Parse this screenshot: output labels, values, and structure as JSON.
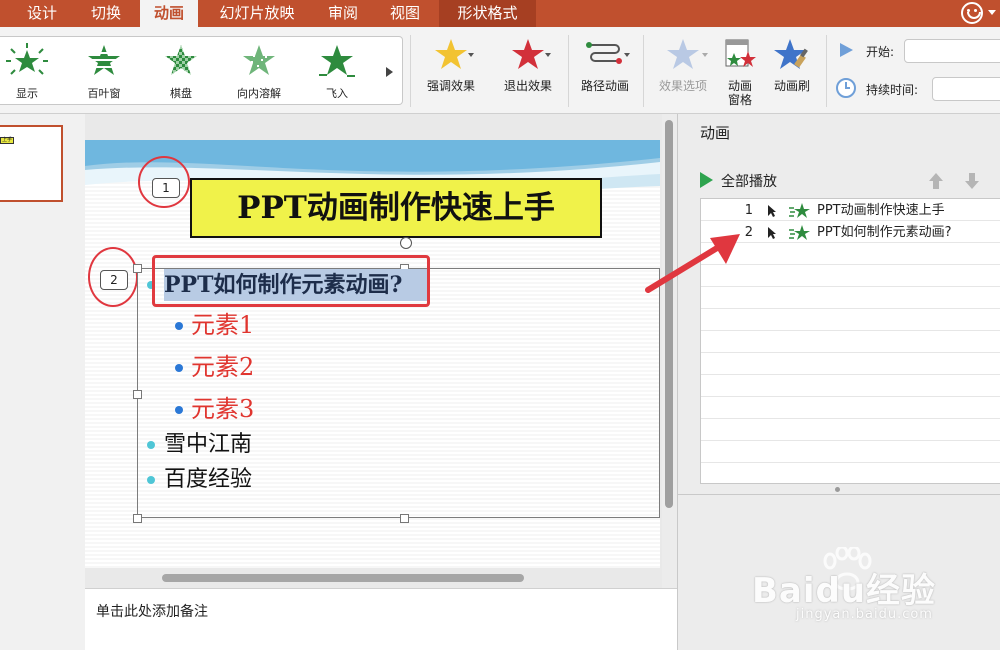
{
  "tabs": [
    {
      "label": "设计",
      "active": false
    },
    {
      "label": "切换",
      "active": false
    },
    {
      "label": "动画",
      "active": true
    },
    {
      "label": "幻灯片放映",
      "active": false
    },
    {
      "label": "审阅",
      "active": false
    },
    {
      "label": "视图",
      "active": false
    },
    {
      "label": "形状格式",
      "active": false
    }
  ],
  "gallery": {
    "items": [
      {
        "label": "显示",
        "icon": "appear-star-icon"
      },
      {
        "label": "百叶窗",
        "icon": "blinds-star-icon"
      },
      {
        "label": "棋盘",
        "icon": "checkerboard-star-icon"
      },
      {
        "label": "向内溶解",
        "icon": "dissolve-in-star-icon"
      },
      {
        "label": "飞入",
        "icon": "fly-in-star-icon"
      }
    ]
  },
  "ribbon": {
    "emphasis_label": "强调效果",
    "exit_label": "退出效果",
    "path_label": "路径动画",
    "options_label": "效果选项",
    "pane_label": "动画窗格",
    "painter_label": "动画刷",
    "start_label": "开始:",
    "duration_label": "持续时间:",
    "start_value": "",
    "duration_value": ""
  },
  "slide": {
    "title": "PPT动画制作快速上手",
    "tag1": "1",
    "tag2": "2",
    "bullet_main": "PPT如何制作元素动画?",
    "bullet_sub1": "元素1",
    "bullet_sub2": "元素2",
    "bullet_sub3": "元素3",
    "bullet_4": "雪中江南",
    "bullet_5": "百度经验",
    "thumb_text": "上手"
  },
  "notes": {
    "placeholder": "单击此处添加备注"
  },
  "panel": {
    "title": "动画",
    "play_all": "全部播放",
    "items": [
      {
        "num": "1",
        "text": "PPT动画制作快速上手"
      },
      {
        "num": "2",
        "text": "PPT如何制作元素动画?"
      }
    ]
  },
  "watermark": {
    "brand": "Baidu经验",
    "url": "jingyan.baidu.com"
  },
  "colors": {
    "accent": "#c0502e",
    "annotation_red": "#e0373f",
    "entrance_green": "#2e8b3e",
    "bullet_blue": "#2b78d6",
    "bullet_cyan": "#4fc6d6",
    "sub_red": "#e0352f"
  }
}
